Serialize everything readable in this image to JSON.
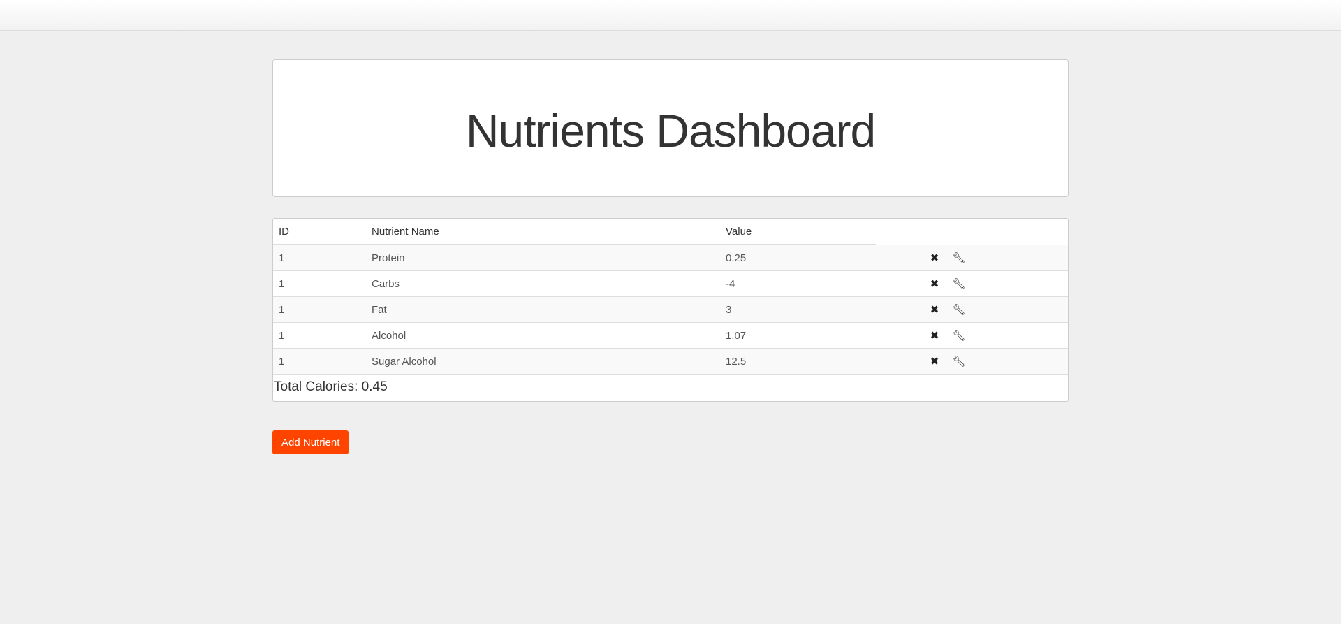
{
  "header": {
    "title": "Nutrients Dashboard"
  },
  "table": {
    "columns": [
      "ID",
      "Nutrient Name",
      "Value"
    ],
    "rows": [
      {
        "id": "1",
        "name": "Protein",
        "value": "0.25",
        "delete_icon": "times-icon",
        "edit_icon": "wrench-icon"
      },
      {
        "id": "1",
        "name": "Carbs",
        "value": "-4",
        "delete_icon": "times-icon",
        "edit_icon": "wrench-icon"
      },
      {
        "id": "1",
        "name": "Fat",
        "value": "3",
        "delete_icon": "times-icon",
        "edit_icon": "wrench-icon"
      },
      {
        "id": "1",
        "name": "Alcohol",
        "value": "1.07",
        "delete_icon": "times-icon",
        "edit_icon": "wrench-icon"
      },
      {
        "id": "1",
        "name": "Sugar Alcohol",
        "value": "12.5",
        "delete_icon": "times-icon",
        "edit_icon": "wrench-icon"
      }
    ]
  },
  "summary": {
    "total_calories": "Total Calories: 0.45"
  },
  "actions": {
    "add_label": "Add Nutrient"
  },
  "colors": {
    "background": "#efefef",
    "accent": "#ff4400"
  }
}
